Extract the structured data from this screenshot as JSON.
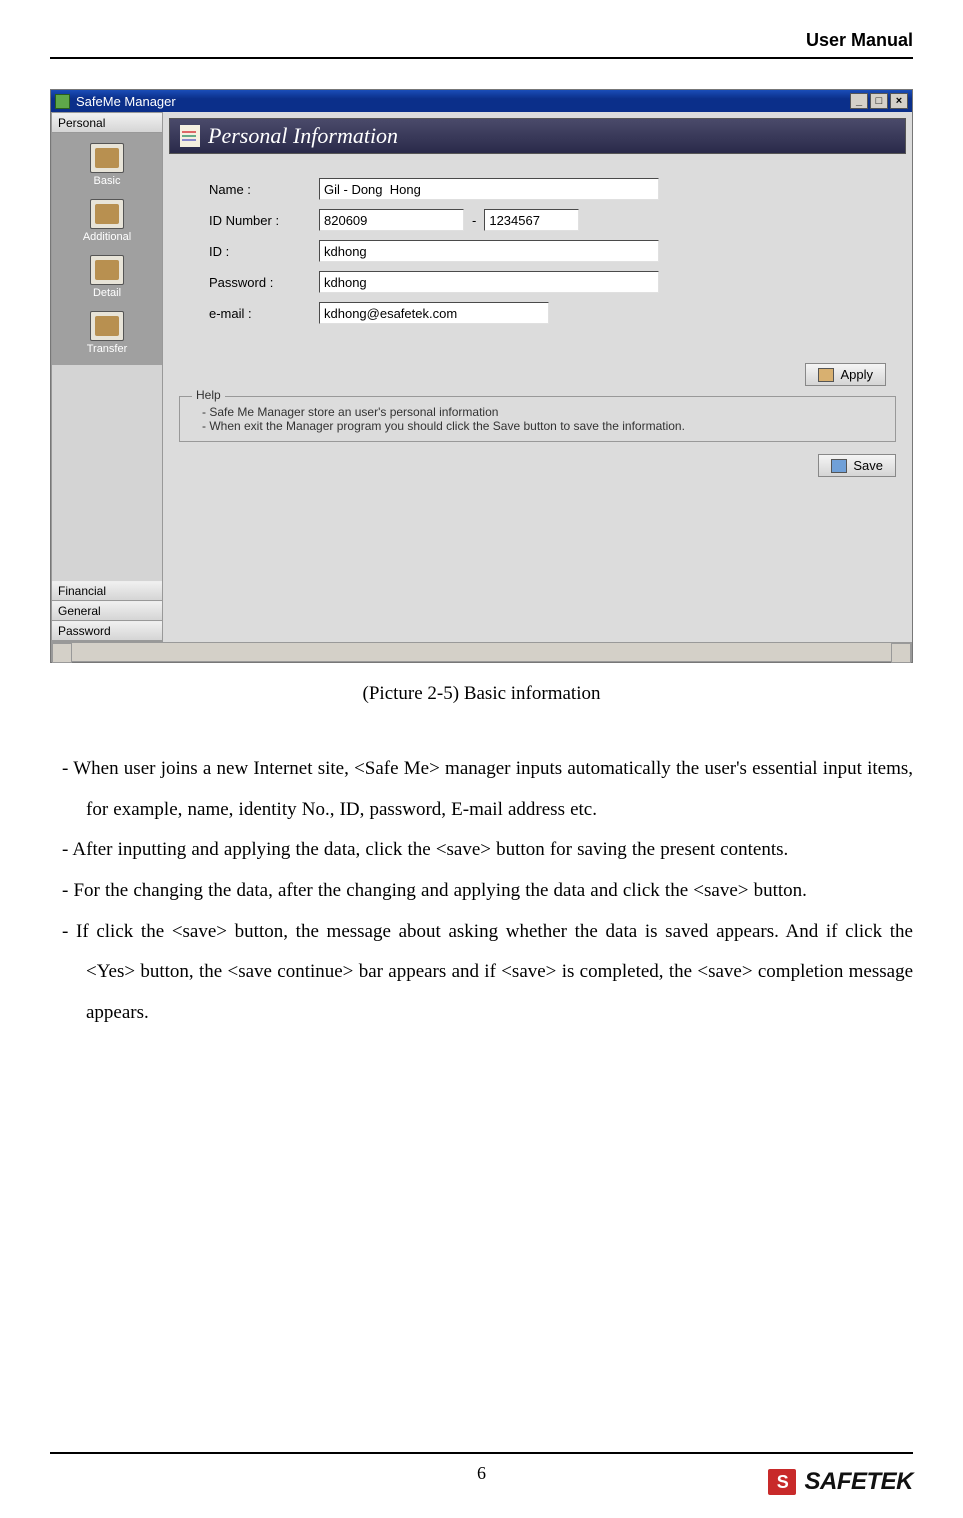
{
  "header": {
    "title": "User Manual"
  },
  "screenshot": {
    "window_title": "SafeMe Manager",
    "sidebar": {
      "accordion_top": "Personal",
      "accordion_bottom": [
        "Financial",
        "General",
        "Password"
      ],
      "items": [
        {
          "label": "Basic"
        },
        {
          "label": "Additional"
        },
        {
          "label": "Detail"
        },
        {
          "label": "Transfer"
        }
      ]
    },
    "section_title": "Personal Information",
    "fields": {
      "name_label": "Name  :",
      "name_value": "Gil - Dong  Hong",
      "idnum_label": "ID Number :",
      "idnum_part1": "820609",
      "idnum_sep": "-",
      "idnum_part2": "1234567",
      "id_label": "ID :",
      "id_value": "kdhong",
      "pw_label": "Password :",
      "pw_value": "kdhong",
      "email_label": "e-mail :",
      "email_value": "kdhong@esafetek.com"
    },
    "buttons": {
      "apply": "Apply",
      "save": "Save"
    },
    "help": {
      "legend": "Help",
      "line1": "- Safe Me Manager store an user's personal information",
      "line2": "- When exit the Manager program you should click the Save button to save the information."
    }
  },
  "caption": "(Picture 2-5) Basic information",
  "body": {
    "p1": "- When user joins a new Internet site, <Safe Me> manager inputs automatically the user's essential input items, for example, name, identity No., ID, password, E-mail address etc.",
    "p2": "- After inputting and applying the data, click the <save> button for saving the present contents.",
    "p3": "- For the changing the data, after the changing and applying the data and click the <save> button.",
    "p4": "- If click the <save> button, the message about asking whether the data is saved appears. And if click the <Yes> button, the <save continue> bar appears and if <save> is completed, the <save> completion message appears."
  },
  "footer": {
    "page_number": "6",
    "logo_text": "SAFETEK"
  }
}
